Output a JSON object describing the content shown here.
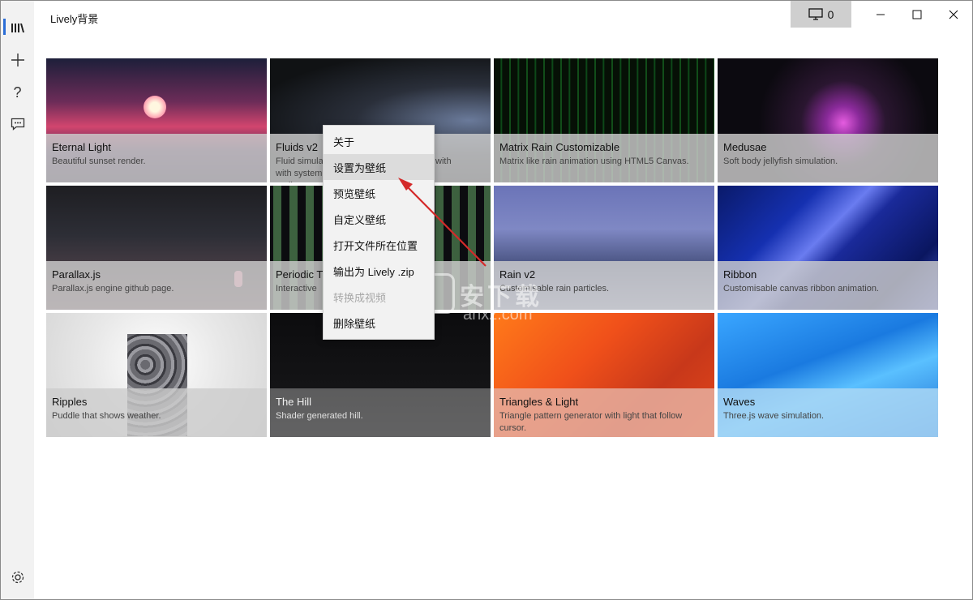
{
  "app": {
    "title": "Lively背景"
  },
  "toolbar": {
    "monitor_count": "0"
  },
  "sidebar": {
    "items": [
      {
        "icon": "library-icon"
      },
      {
        "icon": "add-icon"
      },
      {
        "icon": "help-icon"
      },
      {
        "icon": "feedback-icon"
      },
      {
        "icon": "settings-icon"
      }
    ]
  },
  "wallpapers": [
    {
      "name": "Eternal Light",
      "desc": "Beautiful sunset render."
    },
    {
      "name": "Fluids v2",
      "desc": "Fluid simulation with system audio"
    },
    {
      "name": "Matrix Rain Customizable",
      "desc": "Matrix like rain animation using HTML5 Canvas."
    },
    {
      "name": "Medusae",
      "desc": "Soft body jellyfish simulation."
    },
    {
      "name": "Parallax.js",
      "desc": "Parallax.js engine github page."
    },
    {
      "name": "Periodic T",
      "desc": "Interactive"
    },
    {
      "name": "Rain v2",
      "desc": "Customisable rain particles."
    },
    {
      "name": "Ribbon",
      "desc": "Customisable canvas ribbon animation."
    },
    {
      "name": "Ripples",
      "desc": "Puddle that shows weather."
    },
    {
      "name": "The Hill",
      "desc": "Shader generated hill."
    },
    {
      "name": "Triangles & Light",
      "desc": "Triangle pattern generator with light that follow cursor."
    },
    {
      "name": "Waves",
      "desc": "Three.js wave simulation."
    }
  ],
  "context_menu": {
    "items": [
      "关于",
      "设置为壁纸",
      "预览壁纸",
      "自定义壁纸",
      "打开文件所在位置",
      "输出为 Lively .zip",
      "转换成视频",
      "删除壁纸"
    ]
  },
  "watermark": {
    "line1": "安下载",
    "line2": "anxz.com"
  },
  "colors": {
    "accent": "#2b6dd6",
    "arrow": "#d42a2a"
  }
}
